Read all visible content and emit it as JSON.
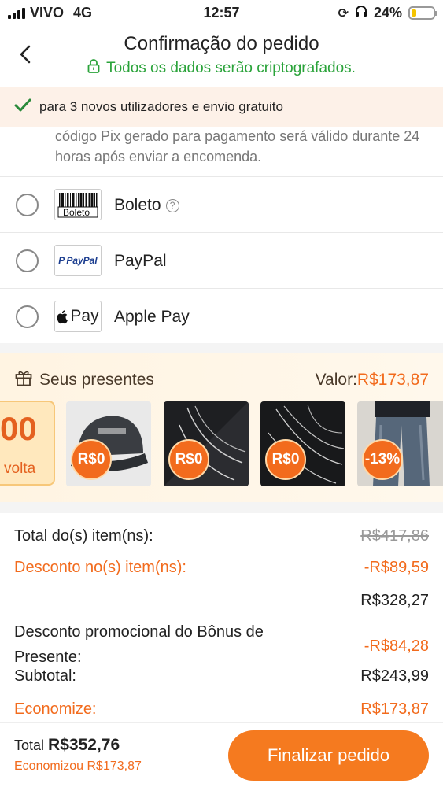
{
  "status_bar": {
    "carrier": "VIVO",
    "network": "4G",
    "time": "12:57",
    "battery": "24%",
    "battery_level": 0.24
  },
  "header": {
    "title": "Confirmação do pedido",
    "subtitle": "Todos os dados serão criptografados."
  },
  "banner": {
    "text": "para 3 novos utilizadores e envio gratuito"
  },
  "pix_note": "código Pix gerado para pagamento será válido durante 24 horas após enviar a encomenda.",
  "payment_options": [
    {
      "label": "Boleto",
      "logo": "Boleto",
      "has_help": true
    },
    {
      "label": "PayPal",
      "logo": "PayPal",
      "has_help": false
    },
    {
      "label": "Apple Pay",
      "logo": "Pay",
      "has_help": false
    }
  ],
  "gifts": {
    "title": "Seus presentes",
    "value_label": "Valor:",
    "value": "R$173,87",
    "coupon_big": "00",
    "coupon_small": "volta",
    "items": [
      {
        "badge": "R$0",
        "image": "cap-image"
      },
      {
        "badge": "R$0",
        "image": "necklace-image"
      },
      {
        "badge": "R$0",
        "image": "chain-image"
      },
      {
        "badge": "-13%",
        "image": "jeans-image"
      }
    ]
  },
  "totals": {
    "items_label": "Total do(s) item(ns):",
    "items_value": "R$417,86",
    "discount_label": "Desconto no(s) item(ns):",
    "discount_value": "-R$89,59",
    "after_discount": "R$328,27",
    "promo_label_1": "Desconto promocional do Bônus de",
    "promo_label_2": "Presente:",
    "promo_value": "-R$84,28",
    "subtotal_label": "Subtotal:",
    "subtotal_value": "R$243,99",
    "save_label": "Economize:",
    "save_value": "R$173,87"
  },
  "bottom": {
    "total_label": "Total",
    "total_value": "R$352,76",
    "saved_text": "Economizou R$173,87",
    "cta": "Finalizar pedido"
  },
  "colors": {
    "accent": "#f26b1d",
    "secure": "#2aa33a",
    "cta": "#f57a1f"
  }
}
